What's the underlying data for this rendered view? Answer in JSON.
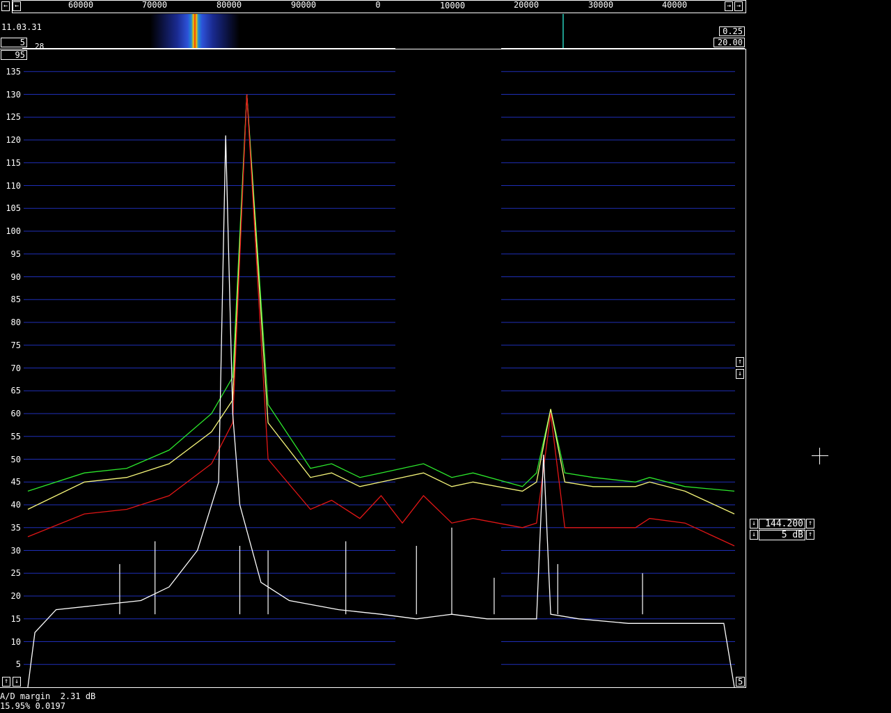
{
  "top_ruler": {
    "labels": [
      "60000",
      "70000",
      "80000",
      "90000",
      "0",
      "10000",
      "20000",
      "30000",
      "40000"
    ],
    "scroll_left_icon": "arrow-left-icon",
    "scroll_right_icon": "arrow-right-icon"
  },
  "waterfall": {
    "time": "11.03.31",
    "avg_value": "5",
    "small_value": "28",
    "level_value": "95",
    "gain_value": "0.25",
    "zero_value": "20.00"
  },
  "controls": {
    "freq_value": "144.200",
    "db_per_div": "5 dB",
    "up_icon": "arrow-up-icon",
    "down_icon": "arrow-down-icon",
    "bottom_right_value": "5"
  },
  "status": {
    "ad_margin": "A/D margin  2.31 dB",
    "cpu_line": "15.95% 0.0197"
  },
  "colors": {
    "grid": "#1f2fb8",
    "green": "#2ce82c",
    "yellow": "#f6f67a",
    "red": "#e21616",
    "white": "#ffffff"
  },
  "chart_data": {
    "type": "line",
    "yticks": [
      5,
      10,
      15,
      20,
      25,
      30,
      35,
      40,
      45,
      50,
      55,
      60,
      65,
      70,
      75,
      80,
      85,
      90,
      95,
      100,
      105,
      110,
      115,
      120,
      125,
      130,
      135
    ],
    "series": [
      {
        "name": "green",
        "x": [
          0,
          0.08,
          0.14,
          0.2,
          0.26,
          0.29,
          0.31,
          0.34,
          0.4,
          0.43,
          0.47,
          0.5,
          0.53,
          0.56,
          0.6,
          0.63,
          0.7,
          0.72,
          0.74,
          0.76,
          0.8,
          0.86,
          0.88,
          0.93,
          1
        ],
        "values": [
          43,
          47,
          48,
          52,
          60,
          68,
          130,
          62,
          48,
          49,
          46,
          47,
          48,
          49,
          46,
          47,
          44,
          47,
          61,
          47,
          46,
          45,
          46,
          44,
          43
        ]
      },
      {
        "name": "yellow",
        "x": [
          0,
          0.08,
          0.14,
          0.2,
          0.26,
          0.29,
          0.31,
          0.34,
          0.4,
          0.43,
          0.47,
          0.5,
          0.53,
          0.56,
          0.6,
          0.63,
          0.7,
          0.72,
          0.74,
          0.76,
          0.8,
          0.86,
          0.88,
          0.93,
          1
        ],
        "values": [
          39,
          45,
          46,
          49,
          56,
          63,
          130,
          58,
          46,
          47,
          44,
          45,
          46,
          47,
          44,
          45,
          43,
          45,
          61,
          45,
          44,
          44,
          45,
          43,
          38
        ]
      },
      {
        "name": "red",
        "x": [
          0,
          0.08,
          0.14,
          0.2,
          0.26,
          0.29,
          0.31,
          0.34,
          0.4,
          0.43,
          0.47,
          0.5,
          0.53,
          0.56,
          0.6,
          0.63,
          0.7,
          0.72,
          0.74,
          0.76,
          0.8,
          0.86,
          0.88,
          0.93,
          1
        ],
        "values": [
          33,
          38,
          39,
          42,
          49,
          58,
          130,
          50,
          39,
          41,
          37,
          42,
          36,
          42,
          36,
          37,
          35,
          36,
          60,
          35,
          35,
          35,
          37,
          36,
          31
        ]
      },
      {
        "name": "white",
        "x": [
          0,
          0.01,
          0.04,
          0.1,
          0.16,
          0.2,
          0.24,
          0.27,
          0.28,
          0.29,
          0.3,
          0.33,
          0.37,
          0.44,
          0.5,
          0.55,
          0.6,
          0.65,
          0.72,
          0.73,
          0.74,
          0.78,
          0.85,
          0.9,
          0.95,
          0.985,
          1
        ],
        "values": [
          0,
          12,
          17,
          18,
          19,
          22,
          30,
          45,
          121,
          60,
          40,
          23,
          19,
          17,
          16,
          15,
          16,
          15,
          15,
          51,
          16,
          15,
          14,
          14,
          14,
          14,
          0
        ]
      }
    ]
  }
}
